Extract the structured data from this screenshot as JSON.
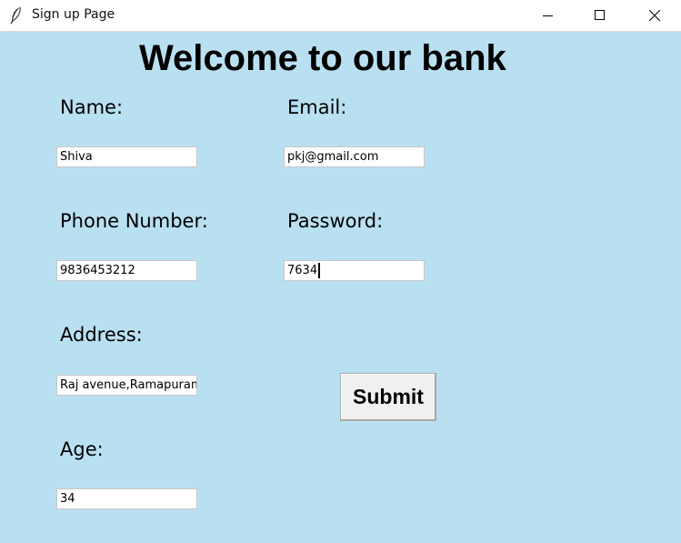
{
  "window": {
    "title": "Sign up Page",
    "icons": {
      "app": "feather-icon",
      "minimize": "minimize-icon",
      "maximize": "maximize-icon",
      "close": "close-icon"
    }
  },
  "heading": "Welcome to our bank",
  "labels": {
    "name": "Name:",
    "email": "Email:",
    "phone": "Phone Number:",
    "password": "Password:",
    "address": "Address:",
    "age": "Age:"
  },
  "fields": {
    "name": "Shiva",
    "email": "pkj@gmail.com",
    "phone": "9836453212",
    "password": "7634",
    "address": "Raj avenue,Ramapuram",
    "age": "34"
  },
  "submit_label": "Submit",
  "colors": {
    "background": "#b9e0f1",
    "button": "#f0f0f0"
  }
}
